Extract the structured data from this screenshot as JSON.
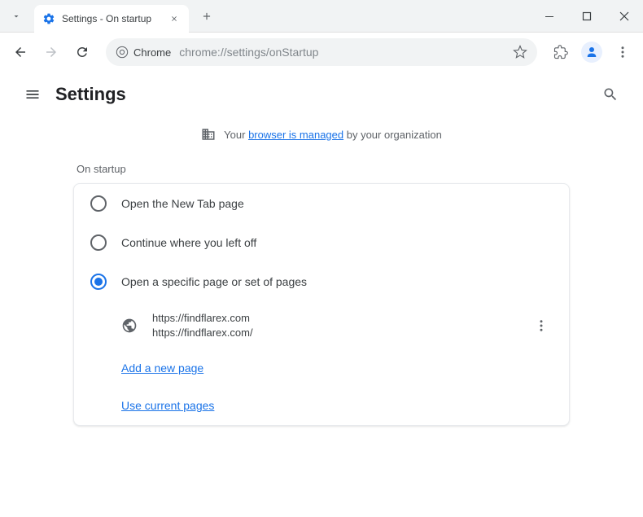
{
  "tab": {
    "title": "Settings - On startup"
  },
  "omnibox": {
    "label": "Chrome",
    "url": "chrome://settings/onStartup"
  },
  "header": {
    "title": "Settings"
  },
  "managed": {
    "prefix": "Your ",
    "link": "browser is managed",
    "suffix": " by your organization"
  },
  "section": {
    "title": "On startup"
  },
  "options": {
    "newtab": "Open the New Tab page",
    "continue": "Continue where you left off",
    "specific": "Open a specific page or set of pages"
  },
  "page": {
    "line1": "https://findflarex.com",
    "line2": "https://findflarex.com/"
  },
  "links": {
    "add_page": "Add a new page",
    "use_current": "Use current pages"
  }
}
